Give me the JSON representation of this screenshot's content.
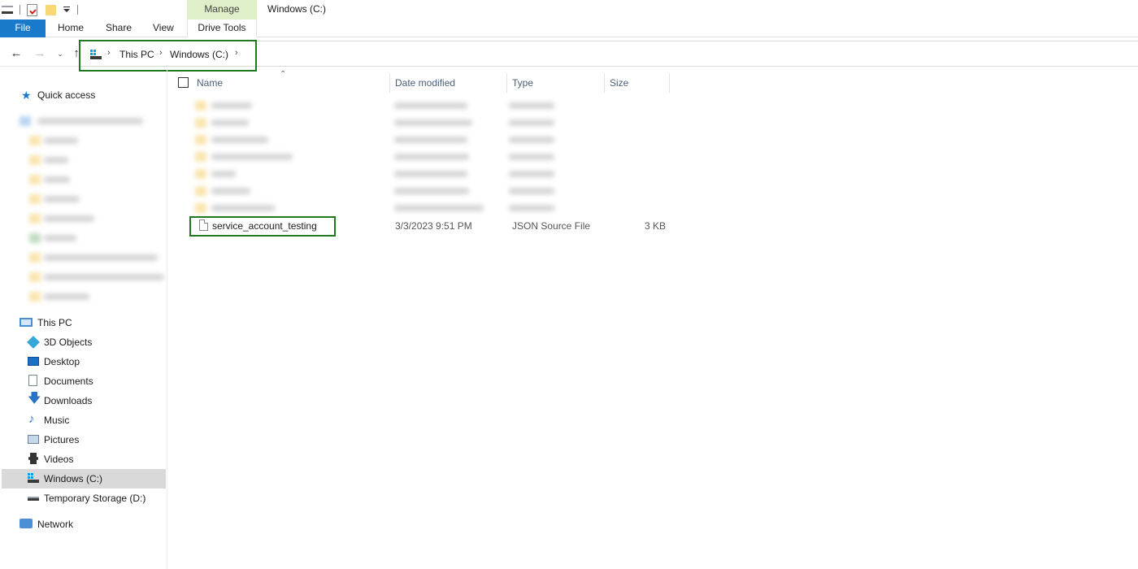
{
  "window": {
    "title": "Windows (C:)",
    "manage_tab": "Manage"
  },
  "ribbon": {
    "tabs": [
      {
        "label": "File"
      },
      {
        "label": "Home"
      },
      {
        "label": "Share"
      },
      {
        "label": "View"
      },
      {
        "label": "Drive Tools"
      }
    ]
  },
  "address": {
    "crumbs": [
      "This PC",
      "Windows (C:)"
    ]
  },
  "sidebar": {
    "quick_access": "Quick access",
    "this_pc": "This PC",
    "items": [
      {
        "label": "3D Objects",
        "icon": "3d-objects-icon"
      },
      {
        "label": "Desktop",
        "icon": "desktop-icon"
      },
      {
        "label": "Documents",
        "icon": "documents-icon"
      },
      {
        "label": "Downloads",
        "icon": "downloads-icon"
      },
      {
        "label": "Music",
        "icon": "music-icon"
      },
      {
        "label": "Pictures",
        "icon": "pictures-icon"
      },
      {
        "label": "Videos",
        "icon": "videos-icon"
      },
      {
        "label": "Windows (C:)",
        "icon": "drive-c-icon"
      },
      {
        "label": "Temporary Storage (D:)",
        "icon": "drive-d-icon"
      }
    ],
    "network": "Network",
    "selected": "Windows (C:)"
  },
  "file_list": {
    "columns": {
      "name": "Name",
      "date": "Date modified",
      "type": "Type",
      "size": "Size"
    },
    "files": [
      {
        "name": "service_account_testing",
        "date": "3/3/2023 9:51 PM",
        "type": "JSON Source File",
        "size": "3 KB"
      }
    ]
  },
  "colors": {
    "file_tab": "#1979ca",
    "manage_tab": "#dff0c9",
    "highlight_box": "#1f7a1f",
    "selected_row": "#d9d9d9"
  }
}
